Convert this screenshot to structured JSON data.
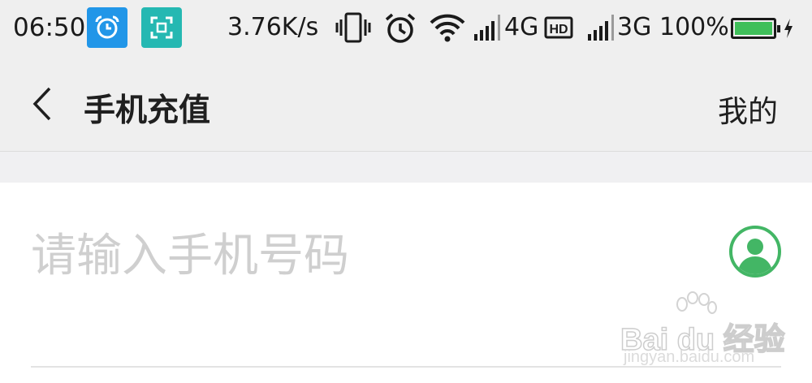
{
  "status_bar": {
    "time": "06:50",
    "net_speed": "3.76K/s",
    "network_primary": "4G",
    "network_secondary": "3G",
    "battery": "100%",
    "battery_level": 1.0,
    "icons": [
      "alarm-app-icon",
      "scan-app-icon",
      "vibrate-icon",
      "alarm-clock-icon",
      "wifi-icon",
      "signal-icon",
      "hd-icon",
      "battery-icon",
      "charging-icon"
    ]
  },
  "nav": {
    "title": "手机充值",
    "right_link": "我的"
  },
  "form": {
    "phone_placeholder": "请输入手机号码",
    "phone_value": ""
  },
  "watermark": {
    "brand": "Bai du 经验",
    "url": "jingyan.baidu.com"
  },
  "colors": {
    "accent_green": "#43b665",
    "status_bar_bg": "#efefef",
    "placeholder": "#cfcfcf"
  }
}
